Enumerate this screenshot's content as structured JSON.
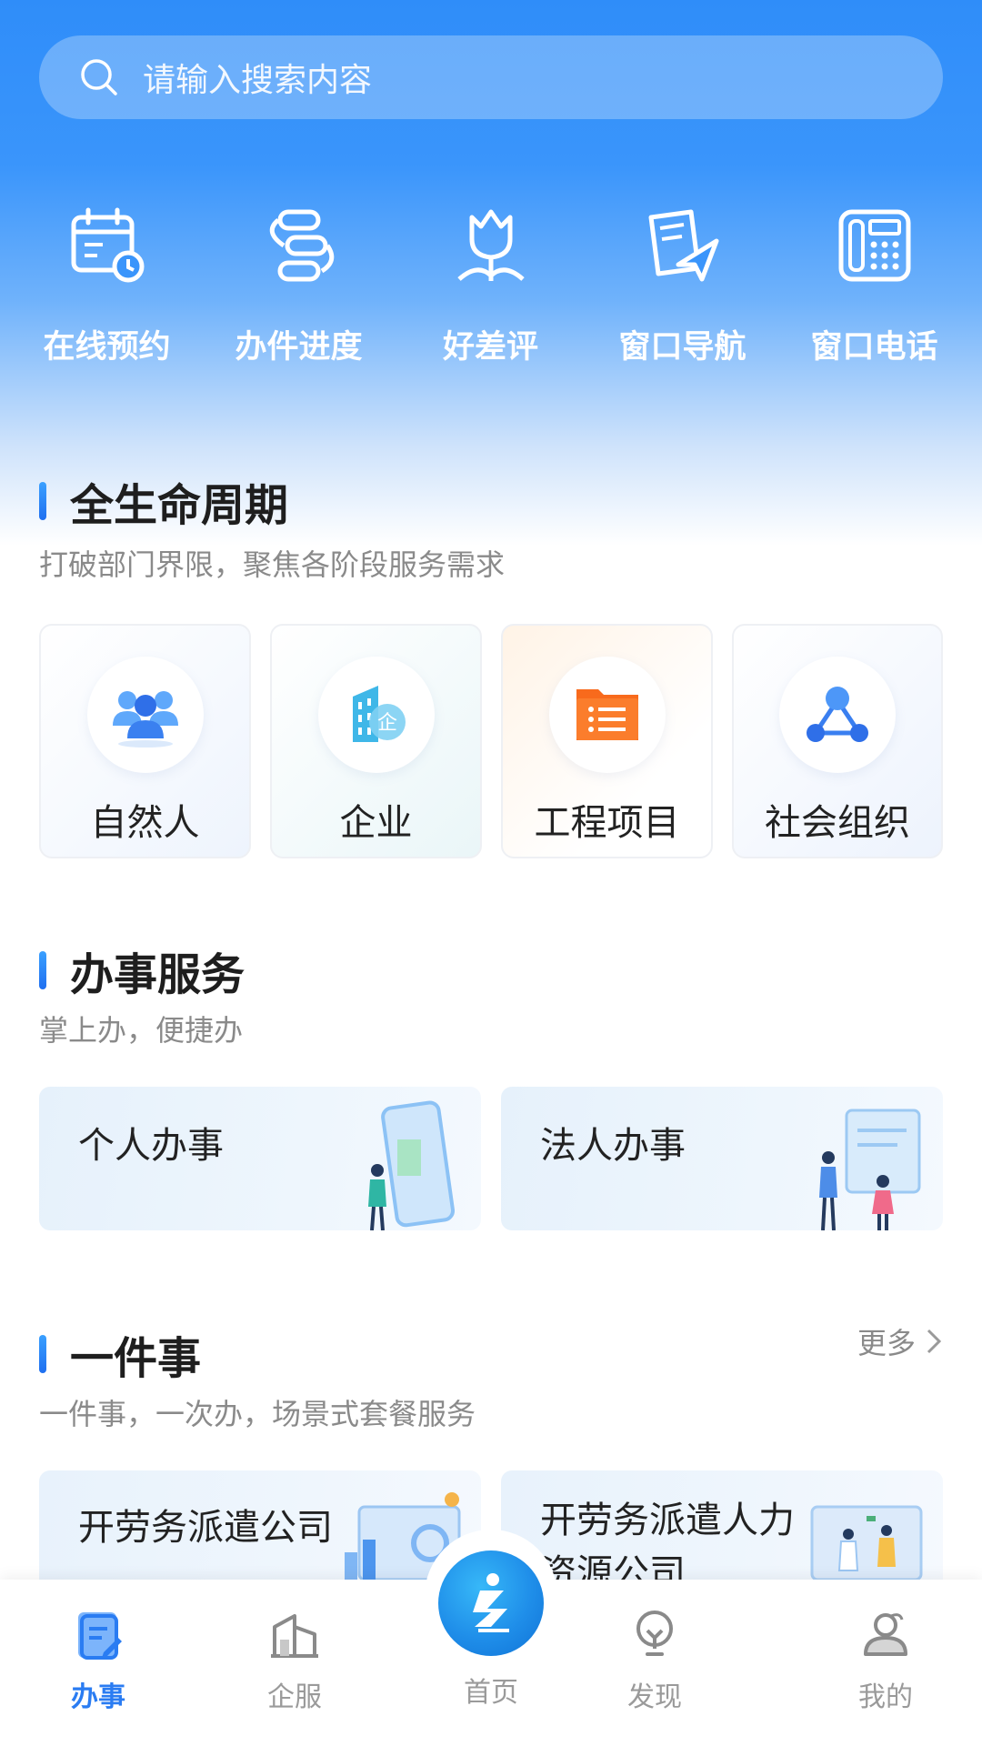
{
  "search": {
    "placeholder": "请输入搜索内容",
    "icon": "search-icon"
  },
  "quick_actions": [
    {
      "label": "在线预约",
      "icon": "calendar-clock-icon"
    },
    {
      "label": "办件进度",
      "icon": "progress-flow-icon"
    },
    {
      "label": "好差评",
      "icon": "tulip-icon"
    },
    {
      "label": "窗口导航",
      "icon": "document-send-icon"
    },
    {
      "label": "窗口电话",
      "icon": "telephone-icon"
    }
  ],
  "lifecycle": {
    "title": "全生命周期",
    "subtitle": "打破部门界限，聚焦各阶段服务需求",
    "cards": [
      {
        "label": "自然人",
        "icon": "people-group-icon"
      },
      {
        "label": "企业",
        "icon": "enterprise-building-icon"
      },
      {
        "label": "工程项目",
        "icon": "folder-list-icon"
      },
      {
        "label": "社会组织",
        "icon": "organization-network-icon"
      }
    ]
  },
  "services": {
    "title": "办事服务",
    "subtitle": "掌上办，便捷办",
    "cards": [
      {
        "label": "个人办事"
      },
      {
        "label": "法人办事"
      }
    ]
  },
  "one_thing": {
    "title": "一件事",
    "subtitle": "一件事，一次办，场景式套餐服务",
    "more": "更多",
    "cards": [
      {
        "label": "开劳务派遣公司"
      },
      {
        "label": "开劳务派遣人力资源公司"
      }
    ]
  },
  "tabbar": {
    "tabs": [
      {
        "label": "办事",
        "icon": "document-edit-icon",
        "active": true
      },
      {
        "label": "企服",
        "icon": "building-icon",
        "active": false
      },
      {
        "label": "首页",
        "icon": "home-logo-icon",
        "active": false
      },
      {
        "label": "发现",
        "icon": "lightbulb-icon",
        "active": false
      },
      {
        "label": "我的",
        "icon": "user-profile-icon",
        "active": false
      }
    ]
  },
  "colors": {
    "primary": "#2f8df9",
    "active_tab": "#2a7cf2",
    "folder_orange": "#f86a1c"
  }
}
